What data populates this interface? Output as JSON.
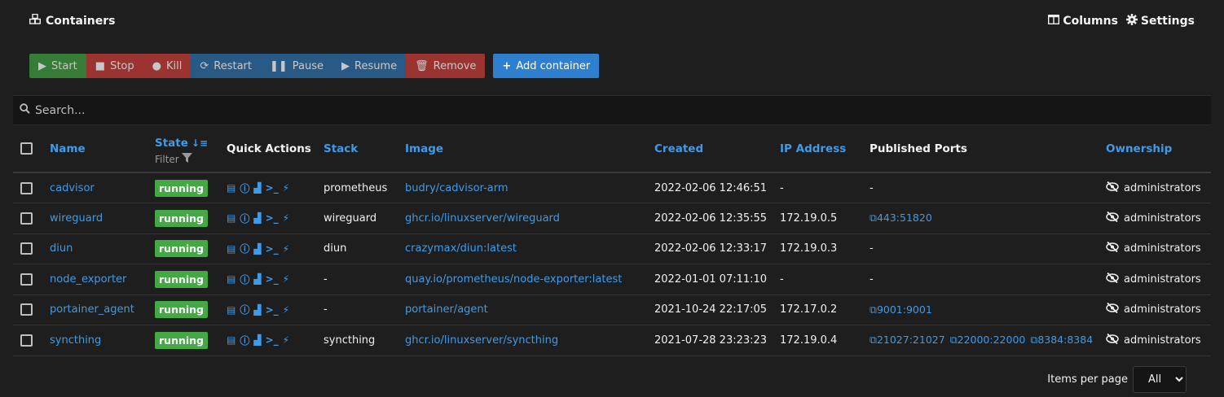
{
  "header": {
    "title": "Containers",
    "columns_label": "Columns",
    "settings_label": "Settings"
  },
  "toolbar": {
    "start": "Start",
    "stop": "Stop",
    "kill": "Kill",
    "restart": "Restart",
    "pause": "Pause",
    "resume": "Resume",
    "remove": "Remove",
    "add_container": "Add container"
  },
  "search": {
    "placeholder": "Search..."
  },
  "table": {
    "headers": {
      "name": "Name",
      "state": "State",
      "filter": "Filter",
      "quick_actions": "Quick Actions",
      "stack": "Stack",
      "image": "Image",
      "created": "Created",
      "ip": "IP Address",
      "ports": "Published Ports",
      "ownership": "Ownership"
    },
    "rows": [
      {
        "name": "cadvisor",
        "state": "running",
        "stack": "prometheus",
        "image": "budry/cadvisor-arm",
        "created": "2022-02-06 12:46:51",
        "ip": "-",
        "ports": [
          "-"
        ],
        "ownership": "administrators"
      },
      {
        "name": "wireguard",
        "state": "running",
        "stack": "wireguard",
        "image": "ghcr.io/linuxserver/wireguard",
        "created": "2022-02-06 12:35:55",
        "ip": "172.19.0.5",
        "ports": [
          "443:51820"
        ],
        "ownership": "administrators"
      },
      {
        "name": "diun",
        "state": "running",
        "stack": "diun",
        "image": "crazymax/diun:latest",
        "created": "2022-02-06 12:33:17",
        "ip": "172.19.0.3",
        "ports": [
          "-"
        ],
        "ownership": "administrators"
      },
      {
        "name": "node_exporter",
        "state": "running",
        "stack": "-",
        "image": "quay.io/prometheus/node-exporter:latest",
        "created": "2022-01-01 07:11:10",
        "ip": "-",
        "ports": [
          "-"
        ],
        "ownership": "administrators"
      },
      {
        "name": "portainer_agent",
        "state": "running",
        "stack": "-",
        "image": "portainer/agent",
        "created": "2021-10-24 22:17:05",
        "ip": "172.17.0.2",
        "ports": [
          "9001:9001"
        ],
        "ownership": "administrators"
      },
      {
        "name": "syncthing",
        "state": "running",
        "stack": "syncthing",
        "image": "ghcr.io/linuxserver/syncthing",
        "created": "2021-07-28 23:23:23",
        "ip": "172.19.0.4",
        "ports": [
          "21027:21027",
          "22000:22000",
          "8384:8384"
        ],
        "ownership": "administrators"
      }
    ]
  },
  "footer": {
    "items_per_page_label": "Items per page",
    "items_per_page_value": "All"
  },
  "colors": {
    "accent": "#3d9be9",
    "running": "#44a844",
    "start": "#3f9a3f",
    "danger": "#c53b36",
    "info": "#2d6ea8",
    "background": "#1e1e1e"
  }
}
